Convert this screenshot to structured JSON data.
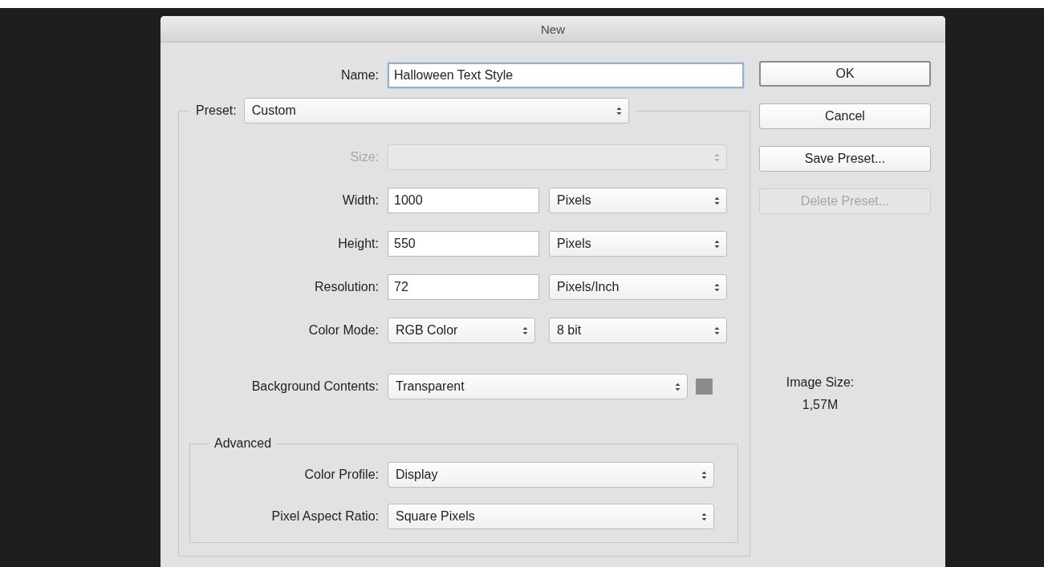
{
  "window": {
    "title": "New"
  },
  "name_field": {
    "label": "Name:",
    "value": "Halloween Text Style",
    "focused": true
  },
  "preset": {
    "label": "Preset:",
    "value": "Custom"
  },
  "rows": [
    {
      "kind": "select",
      "label": "Size:",
      "disabled": true
    },
    {
      "kind": "input_unit",
      "label": "Width:",
      "value": "1000",
      "unit": "Pixels",
      "disabled": false
    },
    {
      "kind": "input_unit",
      "label": "Height:",
      "value": "550",
      "unit": "Pixels",
      "disabled": false
    },
    {
      "kind": "input_unit",
      "label": "Resolution:",
      "value": "72",
      "unit": "Pixels/Inch",
      "disabled": false
    },
    {
      "kind": "select_pair",
      "label": "Color Mode:",
      "value": "RGB Color",
      "unit": "8 bit",
      "disabled": false
    }
  ],
  "background": {
    "label": "Background Contents:",
    "value": "Transparent",
    "color": "#8c8c8c"
  },
  "advanced": {
    "legend": "Advanced",
    "rows": [
      {
        "label": "Color Profile:",
        "value": "Display"
      },
      {
        "label": "Pixel Aspect Ratio:",
        "value": "Square Pixels"
      }
    ]
  },
  "buttons": [
    {
      "label": "OK",
      "default": true,
      "disabled": false
    },
    {
      "label": "Cancel",
      "default": false,
      "disabled": false
    },
    {
      "label": "Save Preset...",
      "default": false,
      "disabled": false
    },
    {
      "label": "Delete Preset...",
      "default": false,
      "disabled": true
    }
  ],
  "image_size": {
    "label": "Image Size:",
    "value": "1,57M"
  }
}
